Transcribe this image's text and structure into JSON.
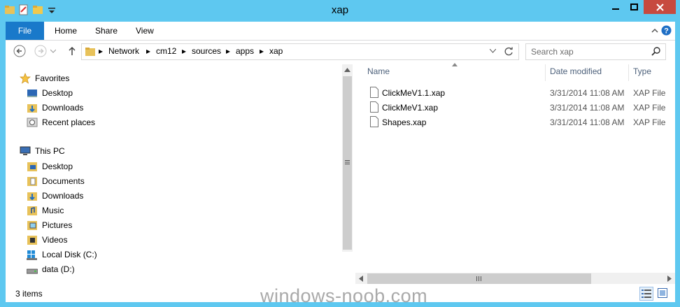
{
  "window": {
    "title": "xap"
  },
  "ribbon": {
    "tabs": [
      "File",
      "Home",
      "Share",
      "View"
    ]
  },
  "address": {
    "crumbs": [
      "Network",
      "cm12",
      "sources",
      "apps",
      "xap"
    ]
  },
  "search": {
    "placeholder": "Search xap"
  },
  "nav": {
    "favorites_label": "Favorites",
    "favorites": [
      "Desktop",
      "Downloads",
      "Recent places"
    ],
    "thispc_label": "This PC",
    "thispc": [
      "Desktop",
      "Documents",
      "Downloads",
      "Music",
      "Pictures",
      "Videos",
      "Local Disk (C:)",
      "data (D:)"
    ]
  },
  "filelist": {
    "columns": [
      "Name",
      "Date modified",
      "Type"
    ],
    "files": [
      {
        "name": "ClickMeV1.1.xap",
        "date": "3/31/2014 11:08 AM",
        "type": "XAP File"
      },
      {
        "name": "ClickMeV1.xap",
        "date": "3/31/2014 11:08 AM",
        "type": "XAP File"
      },
      {
        "name": "Shapes.xap",
        "date": "3/31/2014 11:08 AM",
        "type": "XAP File"
      }
    ]
  },
  "status": {
    "items": "3 items"
  },
  "watermark": "windows-noob.com",
  "colors": {
    "titlebar": "#5ec8f0",
    "file_tab": "#1979ca",
    "close": "#c74a3f"
  }
}
